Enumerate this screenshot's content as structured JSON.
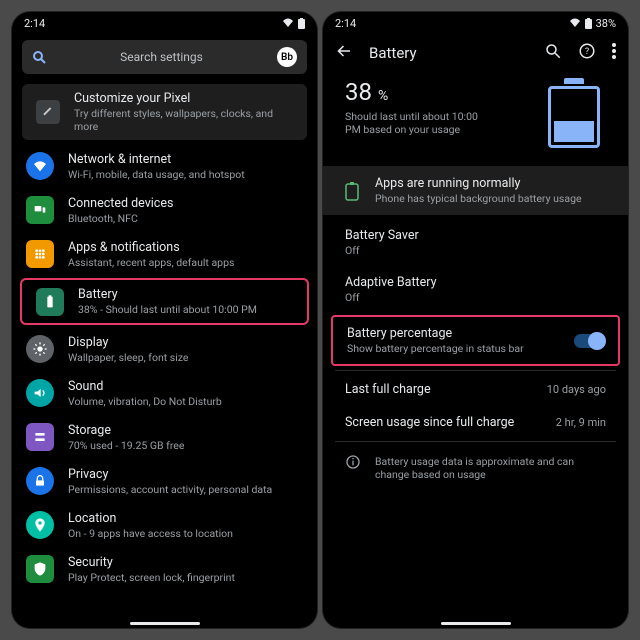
{
  "status": {
    "time": "2:14",
    "pct": "38%"
  },
  "search": {
    "placeholder": "Search settings",
    "avatar": "Bb"
  },
  "customize": {
    "title": "Customize your Pixel",
    "sub": "Try different styles, wallpapers, clocks, and more"
  },
  "settings": [
    {
      "title": "Network & internet",
      "sub": "Wi-Fi, mobile, data usage, and hotspot"
    },
    {
      "title": "Connected devices",
      "sub": "Bluetooth, NFC"
    },
    {
      "title": "Apps & notifications",
      "sub": "Assistant, recent apps, default apps"
    },
    {
      "title": "Battery",
      "sub": "38% - Should last until about 10:00 PM"
    },
    {
      "title": "Display",
      "sub": "Wallpaper, sleep, font size"
    },
    {
      "title": "Sound",
      "sub": "Volume, vibration, Do Not Disturb"
    },
    {
      "title": "Storage",
      "sub": "70% used - 19.25 GB free"
    },
    {
      "title": "Privacy",
      "sub": "Permissions, account activity, personal data"
    },
    {
      "title": "Location",
      "sub": "On - 9 apps have access to location"
    },
    {
      "title": "Security",
      "sub": "Play Protect, screen lock, fingerprint"
    }
  ],
  "battery": {
    "screen_title": "Battery",
    "pct_value": "38",
    "pct_unit": "%",
    "summary": "Should last until about 10:00 PM based on your usage",
    "card_title": "Apps are running normally",
    "card_sub": "Phone has typical background battery usage",
    "items": [
      {
        "title": "Battery Saver",
        "sub": "Off"
      },
      {
        "title": "Adaptive Battery",
        "sub": "Off"
      },
      {
        "title": "Battery percentage",
        "sub": "Show battery percentage in status bar"
      },
      {
        "title": "Last full charge",
        "right": "10 days ago"
      },
      {
        "title": "Screen usage since full charge",
        "right": "2 hr, 9 min"
      }
    ],
    "disclaimer": "Battery usage data is approximate and can change based on usage"
  }
}
